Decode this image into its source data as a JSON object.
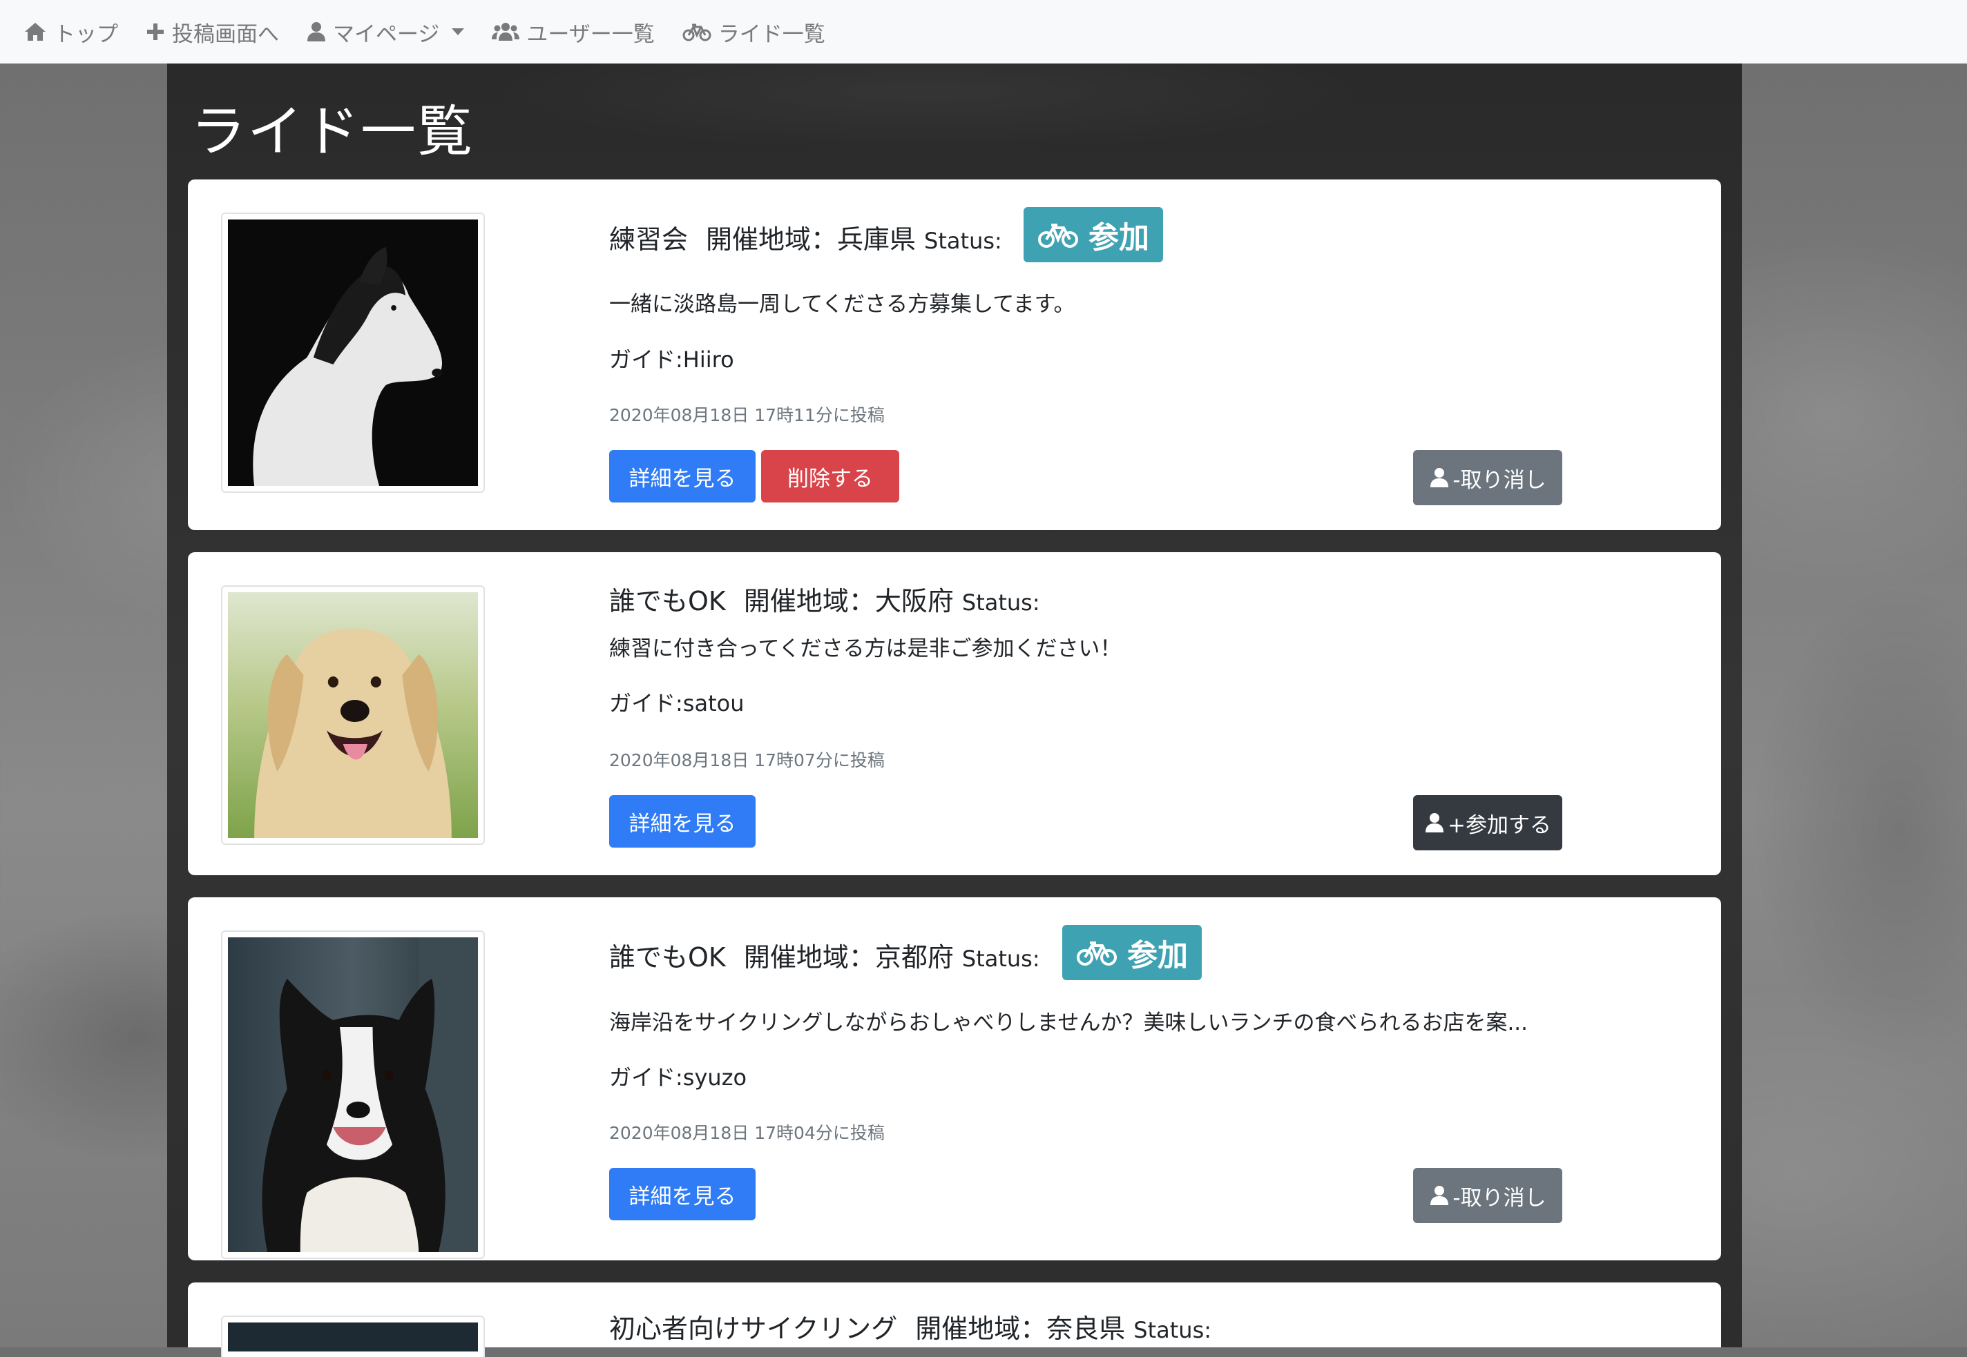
{
  "navbar": {
    "items": [
      {
        "label": "トップ",
        "icon": "home-icon"
      },
      {
        "label": "投稿画面へ",
        "icon": "plus-icon"
      },
      {
        "label": "マイページ",
        "icon": "user-icon"
      },
      {
        "label": "ユーザー一覧",
        "icon": "users-icon"
      },
      {
        "label": "ライド一覧",
        "icon": "bicycle-icon"
      }
    ]
  },
  "page": {
    "title": "ライド一覧"
  },
  "labels": {
    "area_prefix": "開催地域：",
    "status": "Status:",
    "guide_prefix": "ガイド:"
  },
  "rides": [
    {
      "title": "練習会",
      "area": "兵庫県",
      "badge": "参加",
      "description": "一緒に淡路島一周してくださる方募集してます。",
      "guide": "Hiiro",
      "date": "2020年08月18日 17時11分に投稿",
      "detail_label": "詳細を見る",
      "delete_label": "削除する",
      "action_label": "-取り消し",
      "action_type": "cancel",
      "image": "dog-bw-profile"
    },
    {
      "title": "誰でもOK",
      "area": "大阪府",
      "badge": "",
      "description": "練習に付き合ってくださる方は是非ご参加ください！",
      "guide": "satou",
      "date": "2020年08月18日 17時07分に投稿",
      "detail_label": "詳細を見る",
      "action_label": "+参加する",
      "action_type": "join",
      "image": "golden-retriever"
    },
    {
      "title": "誰でもOK",
      "area": "京都府",
      "badge": "参加",
      "description": "海岸沿をサイクリングしながらおしゃべりしませんか？美味しいランチの食べられるお店を案...",
      "guide": "syuzo",
      "date": "2020年08月18日 17時04分に投稿",
      "detail_label": "詳細を見る",
      "action_label": "-取り消し",
      "action_type": "cancel",
      "image": "border-collie"
    },
    {
      "title": "初心者向けサイクリング",
      "area": "奈良県",
      "badge": "",
      "image": "dark-photo"
    }
  ],
  "colors": {
    "primary": "#2f7cf6",
    "danger": "#d9444a",
    "secondary": "#6c757d",
    "dark": "#343a40",
    "badge": "#3fa2b3",
    "navbar_bg": "#f8f9fa"
  }
}
